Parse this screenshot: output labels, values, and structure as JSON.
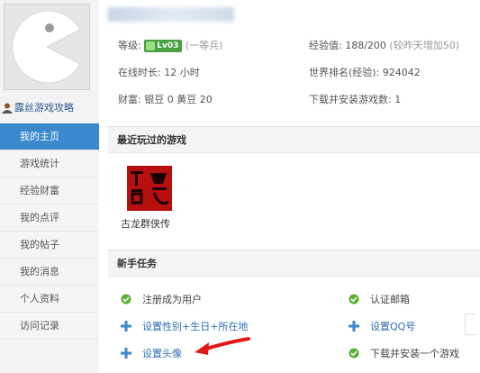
{
  "sidebar": {
    "username": "露丝游戏攻略",
    "menu": [
      {
        "label": "我的主页",
        "active": true
      },
      {
        "label": "游戏统计",
        "active": false
      },
      {
        "label": "经验财富",
        "active": false
      },
      {
        "label": "我的点评",
        "active": false
      },
      {
        "label": "我的帖子",
        "active": false
      },
      {
        "label": "我的消息",
        "active": false
      },
      {
        "label": "个人资料",
        "active": false
      },
      {
        "label": "访问记录",
        "active": false
      }
    ]
  },
  "profile": {
    "level_label": "等级:",
    "level_badge": "Lv03",
    "level_title": "(一等兵)",
    "online_label": "在线时长: 12 小时",
    "wealth_label": "财富: 银豆 0  黄豆 20",
    "exp_label": "经验值: 188/200",
    "exp_note": "(较昨天增加50)",
    "rank_label": "世界排名(经验): 924042",
    "downloads_label": "下载并安装游戏数: 1"
  },
  "recent": {
    "title": "最近玩过的游戏",
    "games": [
      {
        "name": "古龙群侠传",
        "cover_text": "古龍"
      }
    ]
  },
  "tasks": {
    "title": "新手任务",
    "items": [
      {
        "label": "注册成为用户",
        "done": true
      },
      {
        "label": "认证邮箱",
        "done": true
      },
      {
        "label": "设置性别+生日+所在地",
        "done": false
      },
      {
        "label": "设置QQ号",
        "done": false
      },
      {
        "label": "设置头像",
        "done": false
      },
      {
        "label": "下载并安装一个游戏",
        "done": true
      }
    ]
  },
  "colors": {
    "accent": "#3a89cc",
    "link": "#2d6eb5",
    "done_check": "#58b030",
    "plus": "#3a89cc",
    "level_badge": "#4aa044",
    "arrow": "#e01818"
  },
  "icons": {
    "avatar": "pacman-avatar",
    "user": "user-icon",
    "check": "check-circle-icon",
    "plus": "plus-icon"
  }
}
